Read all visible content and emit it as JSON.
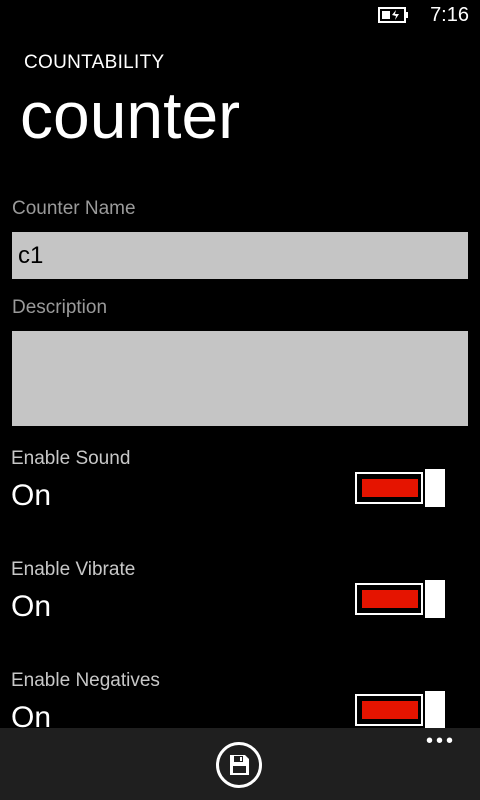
{
  "status_bar": {
    "time": "7:16",
    "battery_icon": "battery-charging-icon"
  },
  "header": {
    "app_title": "COUNTABILITY",
    "page_title": "counter"
  },
  "form": {
    "counter_name_label": "Counter Name",
    "counter_name_value": "c1",
    "description_label": "Description",
    "description_value": ""
  },
  "toggles": [
    {
      "label": "Enable Sound",
      "state": "On",
      "on": true
    },
    {
      "label": "Enable Vibrate",
      "state": "On",
      "on": true
    },
    {
      "label": "Enable Negatives",
      "state": "On",
      "on": true
    }
  ],
  "app_bar": {
    "save_icon": "save-icon",
    "more_label": "•••"
  },
  "colors": {
    "accent": "#e51400",
    "background": "#000000",
    "textbox": "#c5c5c5",
    "app_bar": "#1f1f1f"
  }
}
